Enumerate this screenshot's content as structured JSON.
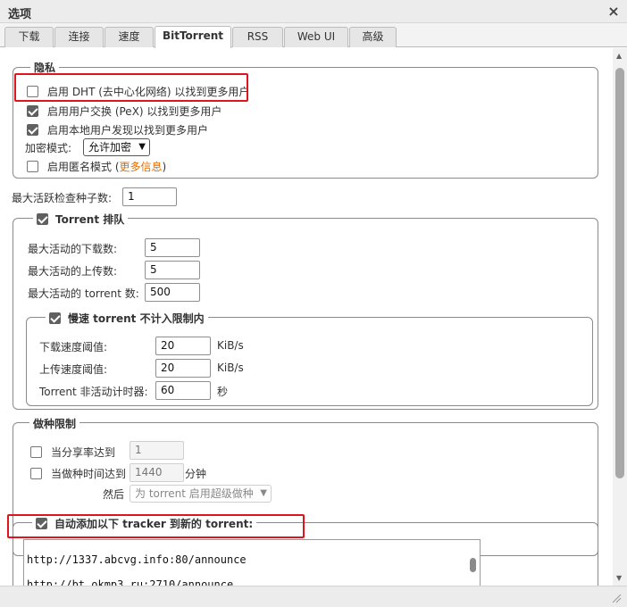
{
  "window": {
    "title": "选项"
  },
  "tabs": [
    {
      "label": "下载",
      "active": false
    },
    {
      "label": "连接",
      "active": false
    },
    {
      "label": "速度",
      "active": false
    },
    {
      "label": "BitTorrent",
      "active": true
    },
    {
      "label": "RSS",
      "active": false
    },
    {
      "label": "Web UI",
      "active": false
    },
    {
      "label": "高级",
      "active": false
    }
  ],
  "privacy": {
    "legend": "隐私",
    "dht": {
      "label": "启用 DHT (去中心化网络) 以找到更多用户",
      "checked": false
    },
    "pex": {
      "label": "启用用户交换 (PeX) 以找到更多用户",
      "checked": true
    },
    "lsd": {
      "label": "启用本地用户发现以找到更多用户",
      "checked": true
    },
    "encryption": {
      "label": "加密模式:",
      "value": "允许加密"
    },
    "anonymous": {
      "label": "启用匿名模式 (",
      "link": "更多信息",
      "suffix": ")",
      "checked": false
    }
  },
  "max_active_checking": {
    "label": "最大活跃检查种子数:",
    "value": "1"
  },
  "queueing": {
    "legend": "Torrent 排队",
    "checked": true,
    "max_downloads": {
      "label": "最大活动的下载数:",
      "value": "5"
    },
    "max_uploads": {
      "label": "最大活动的上传数:",
      "value": "5"
    },
    "max_torrents": {
      "label": "最大活动的 torrent 数:",
      "value": "500"
    },
    "slow": {
      "legend": "慢速 torrent 不计入限制内",
      "checked": true,
      "dl_threshold": {
        "label": "下载速度阈值:",
        "value": "20",
        "unit": "KiB/s"
      },
      "ul_threshold": {
        "label": "上传速度阈值:",
        "value": "20",
        "unit": "KiB/s"
      },
      "inactive_timer": {
        "label": "Torrent 非活动计时器:",
        "value": "60",
        "unit": "秒"
      }
    }
  },
  "seeding": {
    "legend": "做种限制",
    "ratio": {
      "label": "当分享率达到",
      "value": "1",
      "checked": false
    },
    "time": {
      "label": "当做种时间达到",
      "value": "1440",
      "unit": "分钟",
      "checked": false
    },
    "then": {
      "label": "然后",
      "value": "为 torrent 启用超级做种"
    }
  },
  "trackers": {
    "legend": "自动添加以下 tracker 到新的 torrent:",
    "checked": true,
    "lines": [
      "http://1337.abcvg.info:80/announce",
      "http://bt.okmp3.ru:2710/announce"
    ]
  },
  "colors": {
    "highlight": "#e0141e",
    "link": "#e07000"
  }
}
